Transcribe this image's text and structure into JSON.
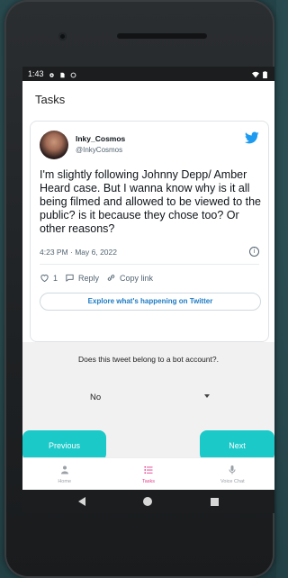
{
  "status_bar": {
    "time": "1:43"
  },
  "app_bar": {
    "title": "Tasks"
  },
  "tweet": {
    "display_name": "Inky_Cosmos",
    "handle": "@InkyCosmos",
    "text": "I'm slightly following Johnny Depp/ Amber Heard case. But I wanna know why is it all being filmed and allowed to be viewed to the public? is it because they chose too? Or other reasons?",
    "timestamp": "4:23 PM · May 6, 2022",
    "like_count": "1",
    "reply_label": "Reply",
    "copy_link_label": "Copy link",
    "explore_label": "Explore what's happening on Twitter",
    "brand_color": "#1d9bf0"
  },
  "question": {
    "prompt": "Does this tweet belong to a bot account?.",
    "selected": "No"
  },
  "buttons": {
    "previous": "Previous",
    "next": "Next",
    "accent": "#1bc9c9"
  },
  "bottom_nav": {
    "items": [
      {
        "label": "Home",
        "icon": "person-icon"
      },
      {
        "label": "Tasks",
        "icon": "tasks-list-icon"
      },
      {
        "label": "Voice Chat",
        "icon": "microphone-icon"
      }
    ],
    "active": "Tasks",
    "active_color": "#e23d8a"
  }
}
